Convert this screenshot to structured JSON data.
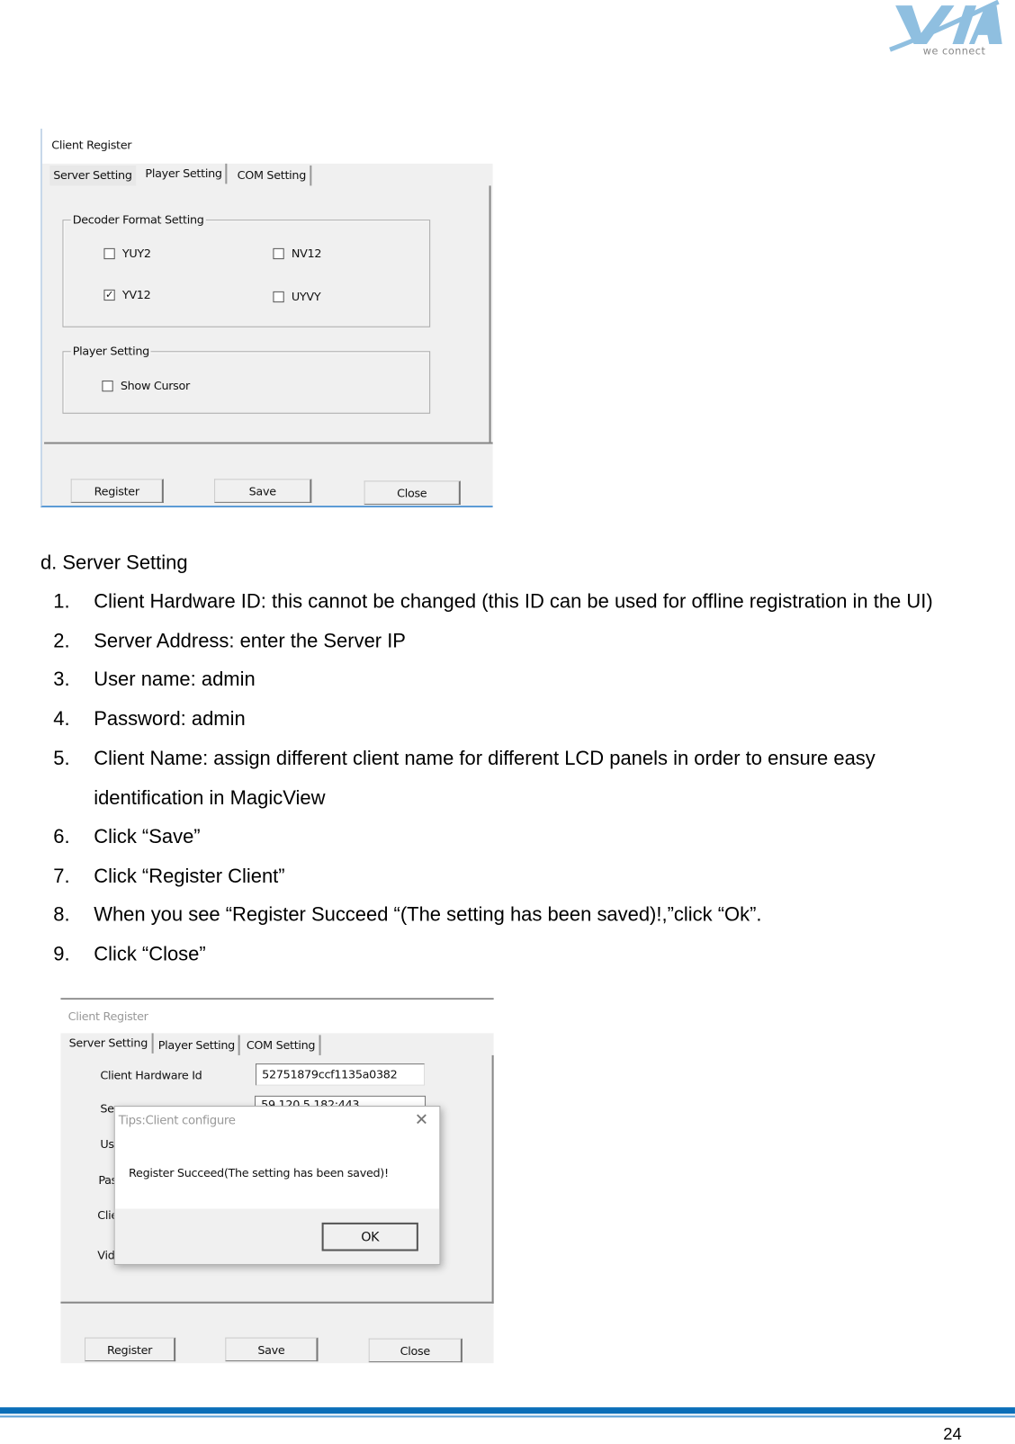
{
  "logo": {
    "text": "VIA",
    "tagline": "we connect",
    "color": "#8fbfe0"
  },
  "dialog1": {
    "title": "Client Register",
    "tabs": [
      "Server Setting",
      "Player Setting",
      "COM Setting"
    ],
    "active_tab": "Player Setting",
    "decoder_group": {
      "title": "Decoder Format Setting",
      "options": [
        {
          "label": "YUY2",
          "checked": false
        },
        {
          "label": "NV12",
          "checked": false
        },
        {
          "label": "YV12",
          "checked": true
        },
        {
          "label": "UYVY",
          "checked": false
        }
      ]
    },
    "player_group": {
      "title": "Player Setting",
      "options": [
        {
          "label": "Show Cursor",
          "checked": false
        }
      ]
    },
    "buttons": {
      "register": "Register",
      "save": "Save",
      "close": "Close"
    }
  },
  "section": {
    "heading": "d.  Server Setting",
    "items": [
      {
        "num": "1.",
        "text": "Client Hardware ID: this cannot be changed (this ID can be used for offline registration in the UI)"
      },
      {
        "num": "2.",
        "text": "Server Address: enter the Server IP"
      },
      {
        "num": "3.",
        "text": "User name: admin"
      },
      {
        "num": "4.",
        "text": "Password: admin"
      },
      {
        "num": "5.",
        "text": "Client Name: assign different client name for different LCD panels in order to ensure easy",
        "cont": "identification in MagicView"
      },
      {
        "num": "6.",
        "text": "Click “Save”"
      },
      {
        "num": "7.",
        "text": "Click “Register Client”"
      },
      {
        "num": "8.",
        "text": "When you see “Register Succeed “(The setting has been saved)!,”click “Ok”."
      },
      {
        "num": "9.",
        "text": "Click “Close”"
      }
    ]
  },
  "dialog2": {
    "title": "Client Register",
    "tabs": [
      "Server Setting",
      "Player Setting",
      "COM Setting"
    ],
    "active_tab": "Server Setting",
    "hardware_id_label": "Client Hardware Id",
    "hardware_id_value": "52751879ccf1135a0382",
    "server_address_partial": "59.120.5.182:443",
    "hidden_labels": [
      "Se",
      "Us",
      "Pas",
      "Clie",
      "Vid"
    ],
    "buttons": {
      "register": "Register",
      "save": "Save",
      "close": "Close"
    },
    "modal": {
      "title": "Tips:Client configure",
      "message": "Register Succeed(The setting has been saved)!",
      "ok": "OK"
    }
  },
  "footer": {
    "page_number": "24",
    "rule_color": "#0a6eb8"
  }
}
